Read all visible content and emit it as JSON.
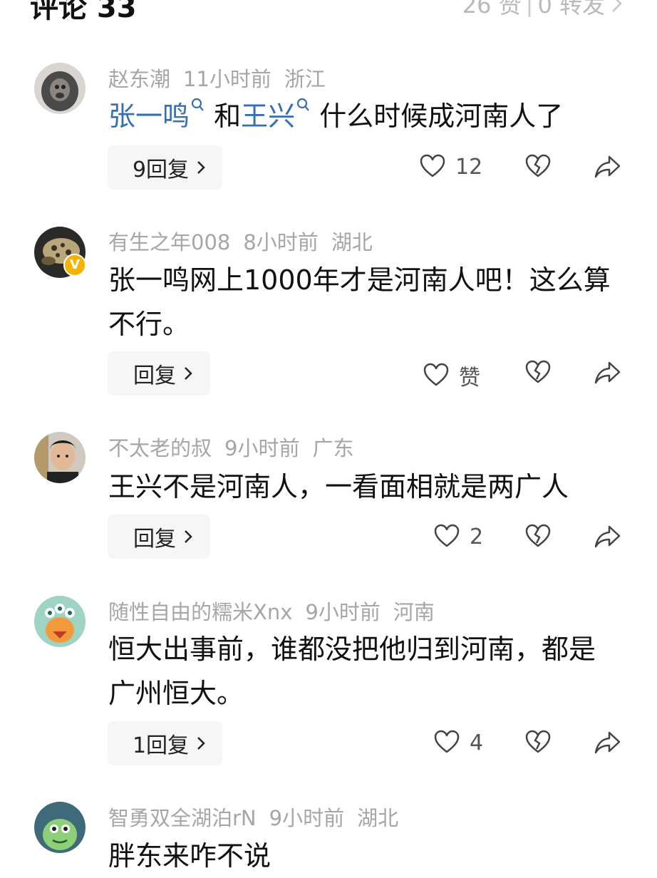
{
  "header": {
    "title": "评论 33",
    "likes": "26 赞",
    "separator": "|",
    "shares": "0 转发"
  },
  "comments": [
    {
      "username": "赵东潮",
      "time": "11小时前",
      "location": "浙江",
      "mention1": "张一鸣",
      "connector": "和",
      "mention2": "王兴",
      "tail": "什么时候成河南人了",
      "reply_label": "9回复",
      "like_count": "12"
    },
    {
      "username": "有生之年008",
      "time": "8小时前",
      "location": "湖北",
      "verified_badge": "V",
      "text": "张一鸣网上1000年才是河南人吧！这么算不行。",
      "reply_label": "回复",
      "like_count": "赞"
    },
    {
      "username": "不太老的叔",
      "time": "9小时前",
      "location": "广东",
      "text": "王兴不是河南人，一看面相就是两广人",
      "reply_label": "回复",
      "like_count": "2"
    },
    {
      "username": "随性自由的糯米Xnx",
      "time": "9小时前",
      "location": "河南",
      "text": "恒大出事前，谁都没把他归到河南，都是广州恒大。",
      "reply_label": "1回复",
      "like_count": "4"
    },
    {
      "username": "智勇双全湖泊rN",
      "time": "9小时前",
      "location": "湖北",
      "text": "胖东来咋不说"
    }
  ],
  "icons": {
    "like": "heart-outline-icon",
    "dislike": "broken-heart-icon",
    "share": "share-arrow-icon",
    "reply_chevron": "chevron-right-icon"
  },
  "colors": {
    "mention": "#3670b3",
    "meta": "#a6a6a6",
    "badge": "#f5b300"
  }
}
